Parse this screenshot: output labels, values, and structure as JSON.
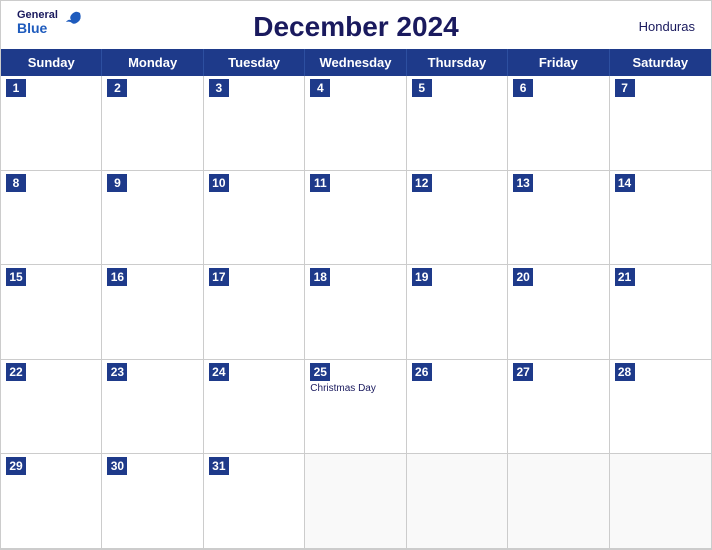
{
  "header": {
    "month_year": "December 2024",
    "country": "Honduras",
    "logo_general": "General",
    "logo_blue": "Blue"
  },
  "day_headers": [
    "Sunday",
    "Monday",
    "Tuesday",
    "Wednesday",
    "Thursday",
    "Friday",
    "Saturday"
  ],
  "weeks": [
    [
      {
        "day": 1,
        "holiday": ""
      },
      {
        "day": 2,
        "holiday": ""
      },
      {
        "day": 3,
        "holiday": ""
      },
      {
        "day": 4,
        "holiday": ""
      },
      {
        "day": 5,
        "holiday": ""
      },
      {
        "day": 6,
        "holiday": ""
      },
      {
        "day": 7,
        "holiday": ""
      }
    ],
    [
      {
        "day": 8,
        "holiday": ""
      },
      {
        "day": 9,
        "holiday": ""
      },
      {
        "day": 10,
        "holiday": ""
      },
      {
        "day": 11,
        "holiday": ""
      },
      {
        "day": 12,
        "holiday": ""
      },
      {
        "day": 13,
        "holiday": ""
      },
      {
        "day": 14,
        "holiday": ""
      }
    ],
    [
      {
        "day": 15,
        "holiday": ""
      },
      {
        "day": 16,
        "holiday": ""
      },
      {
        "day": 17,
        "holiday": ""
      },
      {
        "day": 18,
        "holiday": ""
      },
      {
        "day": 19,
        "holiday": ""
      },
      {
        "day": 20,
        "holiday": ""
      },
      {
        "day": 21,
        "holiday": ""
      }
    ],
    [
      {
        "day": 22,
        "holiday": ""
      },
      {
        "day": 23,
        "holiday": ""
      },
      {
        "day": 24,
        "holiday": ""
      },
      {
        "day": 25,
        "holiday": "Christmas Day"
      },
      {
        "day": 26,
        "holiday": ""
      },
      {
        "day": 27,
        "holiday": ""
      },
      {
        "day": 28,
        "holiday": ""
      }
    ],
    [
      {
        "day": 29,
        "holiday": ""
      },
      {
        "day": 30,
        "holiday": ""
      },
      {
        "day": 31,
        "holiday": ""
      },
      {
        "day": null,
        "holiday": ""
      },
      {
        "day": null,
        "holiday": ""
      },
      {
        "day": null,
        "holiday": ""
      },
      {
        "day": null,
        "holiday": ""
      }
    ]
  ]
}
